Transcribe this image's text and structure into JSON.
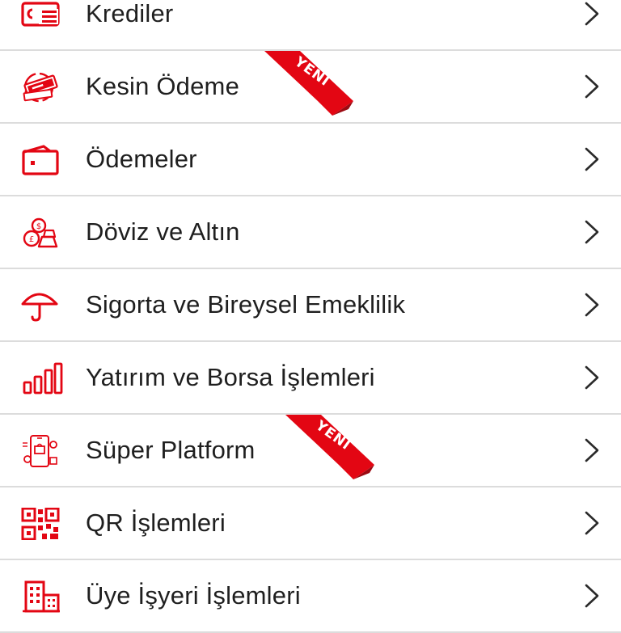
{
  "accent_color": "#e30613",
  "menu": {
    "items": [
      {
        "label": "Krediler",
        "icon": "loan-card-icon",
        "badge": ""
      },
      {
        "label": "Kesin Ödeme",
        "icon": "guaranteed-payment-icon",
        "badge": "YENİ"
      },
      {
        "label": "Ödemeler",
        "icon": "wallet-icon",
        "badge": ""
      },
      {
        "label": "Döviz ve Altın",
        "icon": "currency-gold-icon",
        "badge": ""
      },
      {
        "label": "Sigorta ve Bireysel Emeklilik",
        "icon": "umbrella-icon",
        "badge": ""
      },
      {
        "label": "Yatırım ve Borsa İşlemleri",
        "icon": "bar-chart-icon",
        "badge": ""
      },
      {
        "label": "Süper Platform",
        "icon": "mobile-shopping-icon",
        "badge": "YENİ"
      },
      {
        "label": "QR İşlemleri",
        "icon": "qr-code-icon",
        "badge": ""
      },
      {
        "label": "Üye İşyeri İşlemleri",
        "icon": "merchant-building-icon",
        "badge": ""
      }
    ]
  }
}
